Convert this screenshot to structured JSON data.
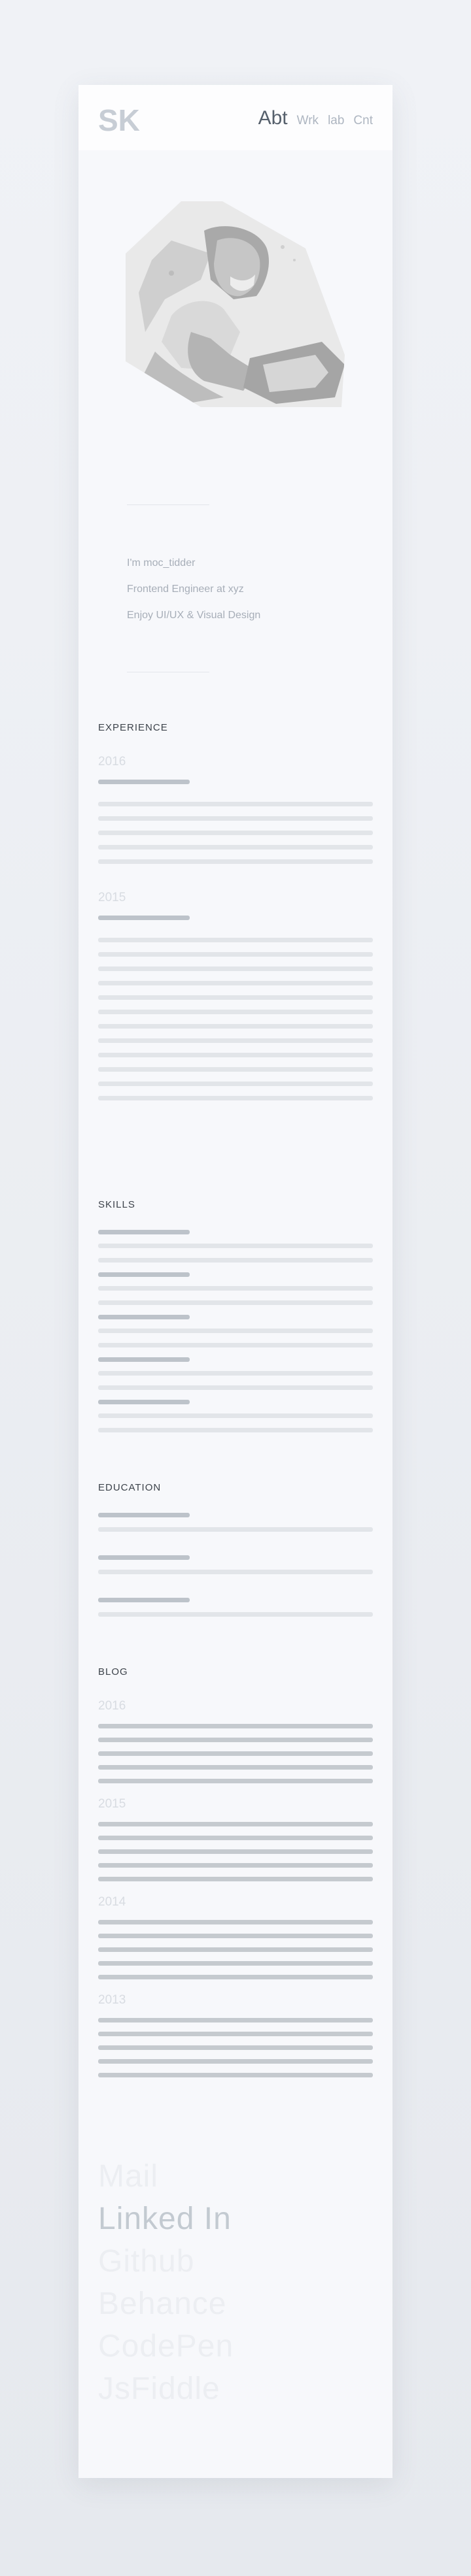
{
  "header": {
    "logo_text": "SK",
    "nav": [
      "Abt",
      "Wrk",
      "lab",
      "Cnt"
    ],
    "active": "Abt"
  },
  "intro": {
    "lines": [
      "I'm moc_tidder",
      "Frontend Engineer at xyz",
      "Enjoy UI/UX & Visual Design"
    ]
  },
  "experience": {
    "title": "EXPERIENCE",
    "entries": [
      {
        "year": "2016"
      },
      {
        "year": "2015"
      }
    ]
  },
  "skills": {
    "title": "SKILLS"
  },
  "education": {
    "title": "EDUCATION"
  },
  "blog": {
    "title": "BLOG",
    "entries": [
      {
        "year": "2016"
      },
      {
        "year": "2015"
      },
      {
        "year": "2014"
      },
      {
        "year": "2013"
      }
    ]
  },
  "links": [
    "Mail",
    "Linked In",
    "Github",
    "Behance",
    "CodePen",
    "JsFiddle"
  ],
  "colors": {
    "card": "#f7f8fb",
    "placeholder_dark": "#bdc3ca",
    "placeholder_light": "#e2e5e9",
    "link_highlight": "#c3cad1",
    "link_faded": "#eceef2"
  }
}
